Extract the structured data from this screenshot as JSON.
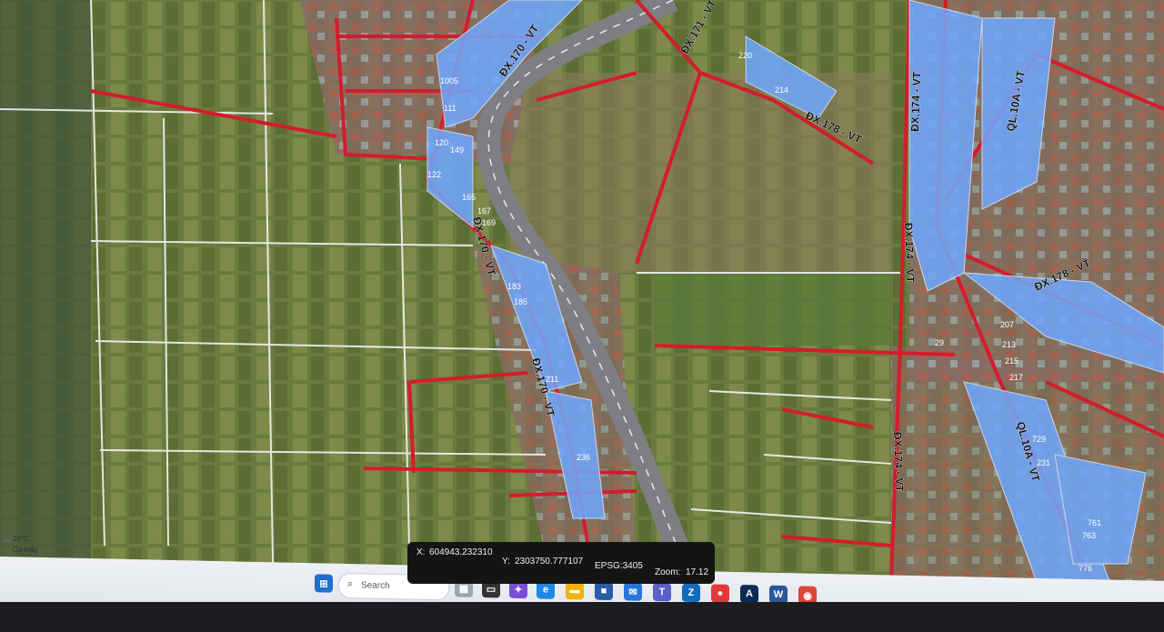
{
  "map": {
    "road_labels": [
      "ĐX.170 - VT",
      "ĐX.171 - VT",
      "ĐX.178 - VT",
      "ĐX.174 - VT",
      "QL.10A - VT",
      "ĐX.178 - VT"
    ],
    "parcel_numbers": [
      "1005",
      "111",
      "120",
      "122",
      "149",
      "165",
      "167",
      "169",
      "183",
      "185",
      "207",
      "211",
      "213",
      "214",
      "215",
      "217",
      "220",
      "231",
      "236",
      "729",
      "761",
      "763",
      "776",
      "29"
    ]
  },
  "status_bar": {
    "x_label": "X:",
    "x_value": "604943.232310",
    "y_label": "Y:",
    "y_value": "2303750.777107",
    "epsg": "EPSG:3405",
    "zoom_label": "Zoom:",
    "zoom_value": "17.12"
  },
  "weather": {
    "temp": "28°C",
    "condition": "Có mây"
  },
  "taskbar": {
    "search_placeholder": "Search"
  },
  "colors": {
    "road": "#d41c2c",
    "parcel_highlight": "#6ea8ff",
    "boundary": "#f3f3f3"
  }
}
